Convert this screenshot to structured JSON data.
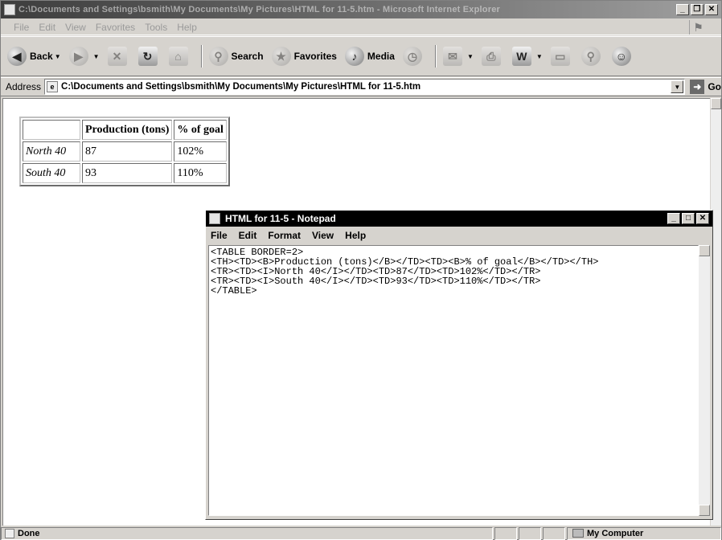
{
  "ie": {
    "title": "C:\\Documents and Settings\\bsmith\\My Documents\\My Pictures\\HTML for 11-5.htm - Microsoft Internet Explorer",
    "menu": [
      "File",
      "Edit",
      "View",
      "Favorites",
      "Tools",
      "Help"
    ],
    "toolbar": {
      "back": "Back",
      "search": "Search",
      "favorites": "Favorites",
      "media": "Media"
    },
    "address_label": "Address",
    "address_value": "C:\\Documents and Settings\\bsmith\\My Documents\\My Pictures\\HTML for 11-5.htm",
    "go_label": "Go",
    "status_text": "Done",
    "zone_text": "My Computer"
  },
  "table": {
    "headers": [
      "",
      "Production (tons)",
      "% of goal"
    ],
    "rows": [
      {
        "name": "North 40",
        "production": "87",
        "goal": "102%"
      },
      {
        "name": "South 40",
        "production": "93",
        "goal": "110%"
      }
    ]
  },
  "notepad": {
    "title": "HTML for 11-5 - Notepad",
    "menu": [
      "File",
      "Edit",
      "Format",
      "View",
      "Help"
    ],
    "text": "<TABLE BORDER=2>\n<TH><TD><B>Production (tons)</B></TD><TD><B>% of goal</B></TD></TH>\n<TR><TD><I>North 40</I></TD><TD>87</TD><TD>102%</TD></TR>\n<TR><TD><I>South 40</I></TD><TD>93</TD><TD>110%</TD></TR>\n</TABLE>"
  },
  "colors": {
    "window_face": "#d6d3ce",
    "notepad_titlebar": "#000000",
    "content_bg": "#ffffff"
  }
}
